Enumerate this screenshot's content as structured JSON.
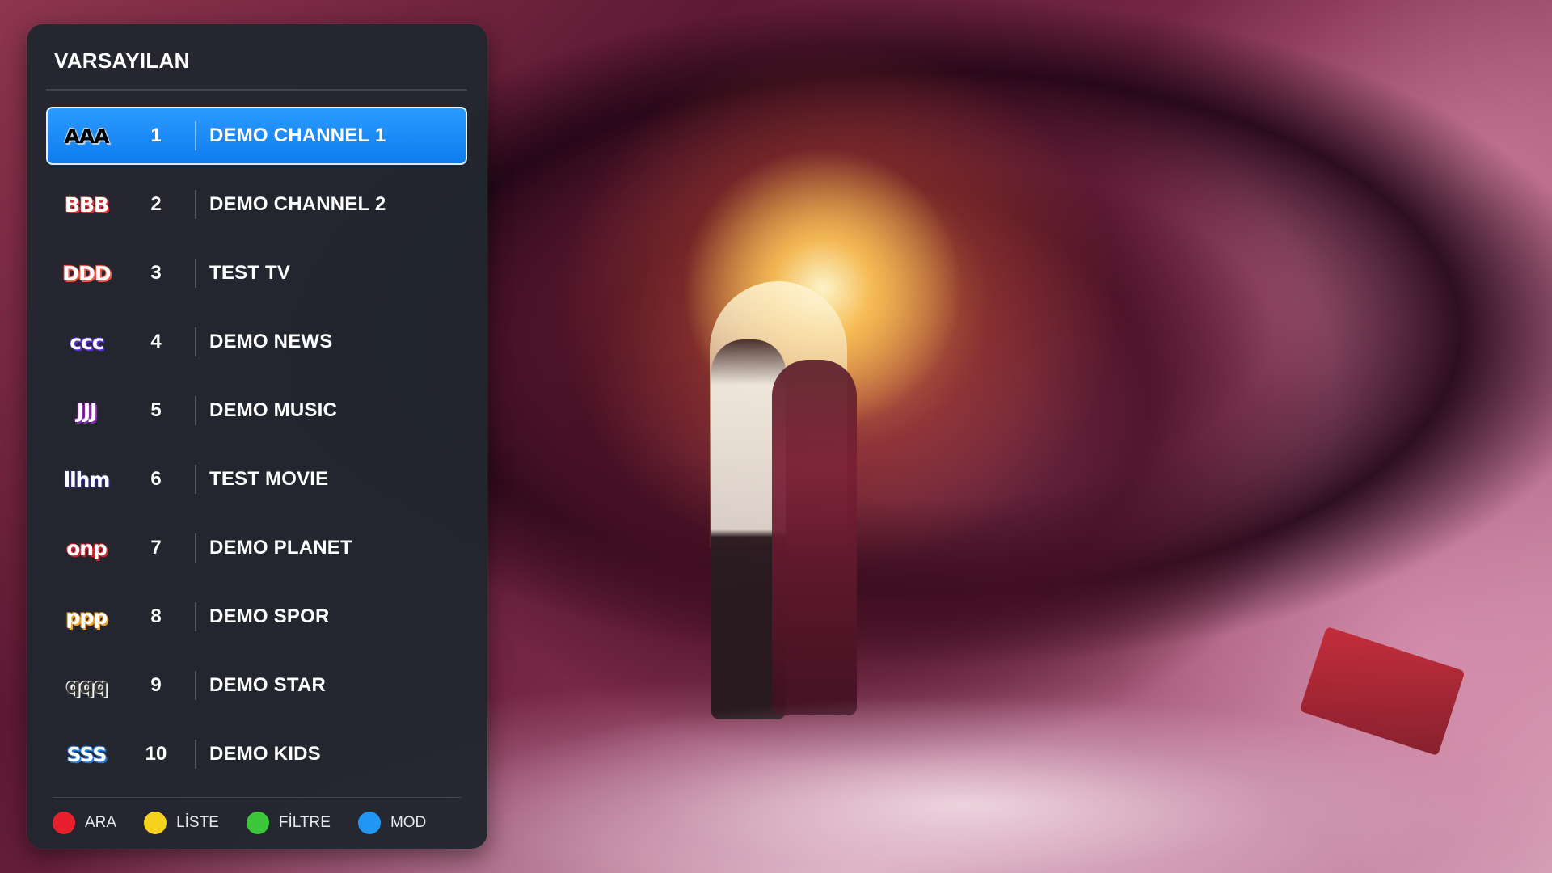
{
  "panel": {
    "title": "VARSAYILAN"
  },
  "channels": [
    {
      "logo_text": "AAA",
      "logo_color": "#000000",
      "logo_bg": "#b9d1e6",
      "number": "1",
      "name": "DEMO CHANNEL 1",
      "active": true
    },
    {
      "logo_text": "BBB",
      "logo_color": "#ffffff",
      "logo_bg": "#e0303a",
      "number": "2",
      "name": "DEMO CHANNEL 2",
      "active": false
    },
    {
      "logo_text": "DDD",
      "logo_color": "#ffffff",
      "logo_bg": "#f0584a",
      "number": "3",
      "name": "TEST TV",
      "active": false
    },
    {
      "logo_text": "ccc",
      "logo_color": "#ffffff",
      "logo_bg": "#5b2fd6",
      "number": "4",
      "name": "DEMO NEWS",
      "active": false
    },
    {
      "logo_text": "JJJ",
      "logo_color": "#ffffff",
      "logo_bg": "#8a2bb0",
      "number": "5",
      "name": "DEMO MUSIC",
      "active": false
    },
    {
      "logo_text": "llhm",
      "logo_color": "#ffffff",
      "logo_bg": "#2d2b6e",
      "number": "6",
      "name": "TEST MOVIE",
      "active": false
    },
    {
      "logo_text": "onp",
      "logo_color": "#ffffff",
      "logo_bg": "#d2252e",
      "number": "7",
      "name": "DEMO PLANET",
      "active": false
    },
    {
      "logo_text": "ppp",
      "logo_color": "#ffffff",
      "logo_bg": "#f0a020",
      "number": "8",
      "name": "DEMO SPOR",
      "active": false
    },
    {
      "logo_text": "qqq",
      "logo_color": "#333333",
      "logo_bg": "#f2f2f2",
      "number": "9",
      "name": "DEMO STAR",
      "active": false
    },
    {
      "logo_text": "SSS",
      "logo_color": "#ffffff",
      "logo_bg": "#1e7fe0",
      "number": "10",
      "name": "DEMO KIDS",
      "active": false
    }
  ],
  "legend": [
    {
      "label": "ARA",
      "color": "#e8202e"
    },
    {
      "label": "LİSTE",
      "color": "#f7d21c"
    },
    {
      "label": "FİLTRE",
      "color": "#3cc63a"
    },
    {
      "label": "MOD",
      "color": "#2196f3"
    }
  ]
}
